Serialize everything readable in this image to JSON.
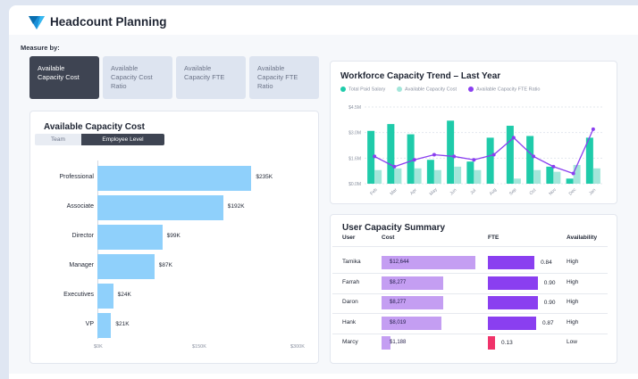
{
  "app": {
    "title": "Headcount Planning",
    "logo_icon": "brand-logo-icon"
  },
  "measure": {
    "label": "Measure by:",
    "tabs": [
      {
        "label": "Available\nCapacity Cost",
        "active": true
      },
      {
        "label": "Available\nCapacity Cost\nRatio",
        "active": false
      },
      {
        "label": "Available\nCapacity FTE",
        "active": false
      },
      {
        "label": "Available\nCapacity FTE\nRatio",
        "active": false
      }
    ]
  },
  "capacity_cost": {
    "title": "Available Capacity Cost",
    "toggle": {
      "team": "Team",
      "employee": "Employee Level"
    }
  },
  "trend": {
    "title": "Workforce Capacity Trend – Last Year",
    "legend": [
      "Total Paid Salary",
      "Available Capacity Cost",
      "Available Capacity FTE Ratio"
    ]
  },
  "summary": {
    "title": "User Capacity Summary",
    "headers": {
      "user": "User",
      "cost": "Cost",
      "fte": "FTE",
      "availability": "Availability"
    },
    "rows": [
      {
        "user": "Tamika",
        "cost": "$12,644",
        "cost_value": 12644,
        "fte": "0.84",
        "fte_value": 0.84,
        "availability": "High"
      },
      {
        "user": "Farrah",
        "cost": "$8,277",
        "cost_value": 8277,
        "fte": "0.90",
        "fte_value": 0.9,
        "availability": "High"
      },
      {
        "user": "Daron",
        "cost": "$8,277",
        "cost_value": 8277,
        "fte": "0.90",
        "fte_value": 0.9,
        "availability": "High"
      },
      {
        "user": "Hank",
        "cost": "$8,019",
        "cost_value": 8019,
        "fte": "0.87",
        "fte_value": 0.87,
        "availability": "High"
      },
      {
        "user": "Marcy",
        "cost": "$1,188",
        "cost_value": 1188,
        "fte": "0.13",
        "fte_value": 0.13,
        "availability": "Low"
      }
    ]
  },
  "colors": {
    "salary": "#1fcbaa",
    "capacity_cost": "#a3e6da",
    "fte_ratio": "#8a3ff0",
    "hbar": "#8fd0fb",
    "active_tab": "#3e4452",
    "low_fte": "#f0336a"
  },
  "chart_data": [
    {
      "type": "bar",
      "orientation": "horizontal",
      "title": "Available Capacity Cost",
      "categories": [
        "Professional",
        "Associate",
        "Director",
        "Manager",
        "Executives",
        "VP"
      ],
      "values": [
        235,
        192,
        99,
        87,
        24,
        21
      ],
      "value_labels": [
        "$235K",
        "$192K",
        "$99K",
        "$87K",
        "$24K",
        "$21K"
      ],
      "xlim": [
        0,
        300
      ],
      "x_ticks": [
        "$0K",
        "$150K",
        "$300K"
      ]
    },
    {
      "type": "bar",
      "title": "Workforce Capacity Trend – Last Year",
      "categories": [
        "Feb",
        "Mar",
        "Apr",
        "May",
        "Jun",
        "Jul",
        "Aug",
        "Sep",
        "Oct",
        "Nov",
        "Dec",
        "Jan"
      ],
      "y_ticks": [
        "$0.0M",
        "$1.6M",
        "$3.0M",
        "$4.5M"
      ],
      "ylim": [
        0,
        4.5
      ],
      "series": [
        {
          "name": "Total Paid Salary",
          "kind": "bar",
          "values": [
            3.1,
            3.5,
            2.9,
            1.4,
            3.7,
            1.3,
            2.7,
            3.4,
            2.8,
            1.0,
            0.3,
            2.7
          ]
        },
        {
          "name": "Available Capacity Cost",
          "kind": "bar",
          "values": [
            0.8,
            0.9,
            0.9,
            0.8,
            1.0,
            0.8,
            0.0,
            0.3,
            0.8,
            0.7,
            1.1,
            0.9
          ]
        },
        {
          "name": "Available Capacity FTE Ratio",
          "kind": "line",
          "values": [
            1.6,
            1.0,
            1.4,
            1.7,
            1.6,
            1.4,
            1.7,
            2.7,
            1.6,
            1.0,
            0.6,
            3.2
          ]
        }
      ]
    }
  ]
}
